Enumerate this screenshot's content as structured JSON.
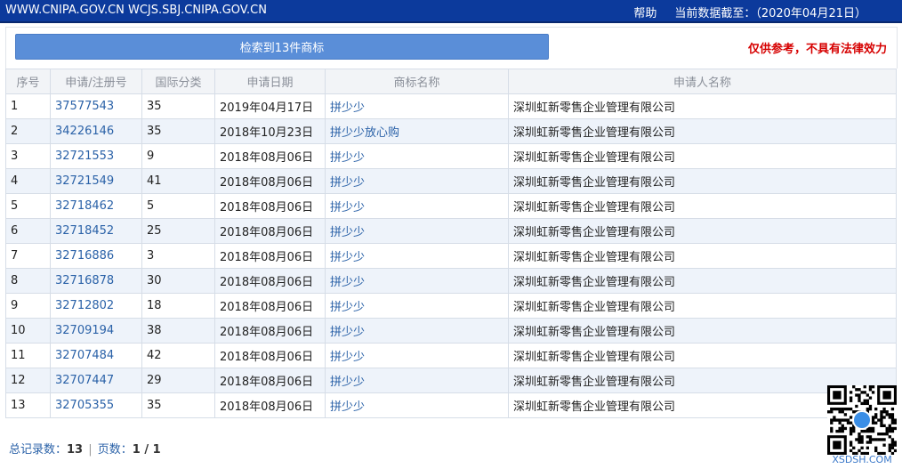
{
  "topbar": {
    "sites": "WWW.CNIPA.GOV.CN WCJS.SBJ.CNIPA.GOV.CN",
    "help": "帮助",
    "data_date": "当前数据截至：（2020年04月21日）"
  },
  "summary": {
    "result_label": "检索到13件商标",
    "disclaimer": "仅供参考，不具有法律效力"
  },
  "table": {
    "headers": [
      "序号",
      "申请/注册号",
      "国际分类",
      "申请日期",
      "商标名称",
      "申请人名称"
    ],
    "rows": [
      [
        "1",
        "37577543",
        "35",
        "2019年04月17日",
        "拼少少",
        "深圳虹新零售企业管理有限公司"
      ],
      [
        "2",
        "34226146",
        "35",
        "2018年10月23日",
        "拼少少放心购",
        "深圳虹新零售企业管理有限公司"
      ],
      [
        "3",
        "32721553",
        "9",
        "2018年08月06日",
        "拼少少",
        "深圳虹新零售企业管理有限公司"
      ],
      [
        "4",
        "32721549",
        "41",
        "2018年08月06日",
        "拼少少",
        "深圳虹新零售企业管理有限公司"
      ],
      [
        "5",
        "32718462",
        "5",
        "2018年08月06日",
        "拼少少",
        "深圳虹新零售企业管理有限公司"
      ],
      [
        "6",
        "32718452",
        "25",
        "2018年08月06日",
        "拼少少",
        "深圳虹新零售企业管理有限公司"
      ],
      [
        "7",
        "32716886",
        "3",
        "2018年08月06日",
        "拼少少",
        "深圳虹新零售企业管理有限公司"
      ],
      [
        "8",
        "32716878",
        "30",
        "2018年08月06日",
        "拼少少",
        "深圳虹新零售企业管理有限公司"
      ],
      [
        "9",
        "32712802",
        "18",
        "2018年08月06日",
        "拼少少",
        "深圳虹新零售企业管理有限公司"
      ],
      [
        "10",
        "32709194",
        "38",
        "2018年08月06日",
        "拼少少",
        "深圳虹新零售企业管理有限公司"
      ],
      [
        "11",
        "32707484",
        "42",
        "2018年08月06日",
        "拼少少",
        "深圳虹新零售企业管理有限公司"
      ],
      [
        "12",
        "32707447",
        "29",
        "2018年08月06日",
        "拼少少",
        "深圳虹新零售企业管理有限公司"
      ],
      [
        "13",
        "32705355",
        "35",
        "2018年08月06日",
        "拼少少",
        "深圳虹新零售企业管理有限公司"
      ]
    ]
  },
  "footer": {
    "total_label": "总记录数：",
    "total_value": "13",
    "sep": "|",
    "pages_label": "页数：",
    "pages_value": "1 / 1"
  },
  "watermark": {
    "text": "XSDSH.COM",
    "icon": "qr-code-icon"
  },
  "colors": {
    "topbar": "#0c3a9c",
    "button": "#5a8ed8",
    "link": "#2b62a8",
    "disclaimer": "#d60000",
    "row_alt": "#eef3fa"
  }
}
